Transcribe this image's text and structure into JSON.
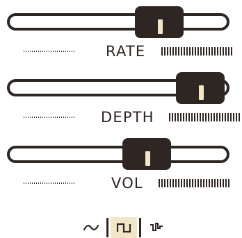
{
  "colors": {
    "ink": "#2e2623",
    "accent": "#f2e6c9",
    "background": "#ffffff"
  },
  "sliders": [
    {
      "id": "rate",
      "label": "RATE",
      "value": 0.64
    },
    {
      "id": "depth",
      "label": "DEPTH",
      "value": 0.87
    },
    {
      "id": "vol",
      "label": "VOL",
      "value": 0.67
    }
  ],
  "waveforms": {
    "options": [
      {
        "id": "sine",
        "icon": "sine-wave-icon"
      },
      {
        "id": "square",
        "icon": "square-wave-icon"
      },
      {
        "id": "random",
        "icon": "random-step-wave-icon"
      }
    ],
    "selected": "square"
  }
}
